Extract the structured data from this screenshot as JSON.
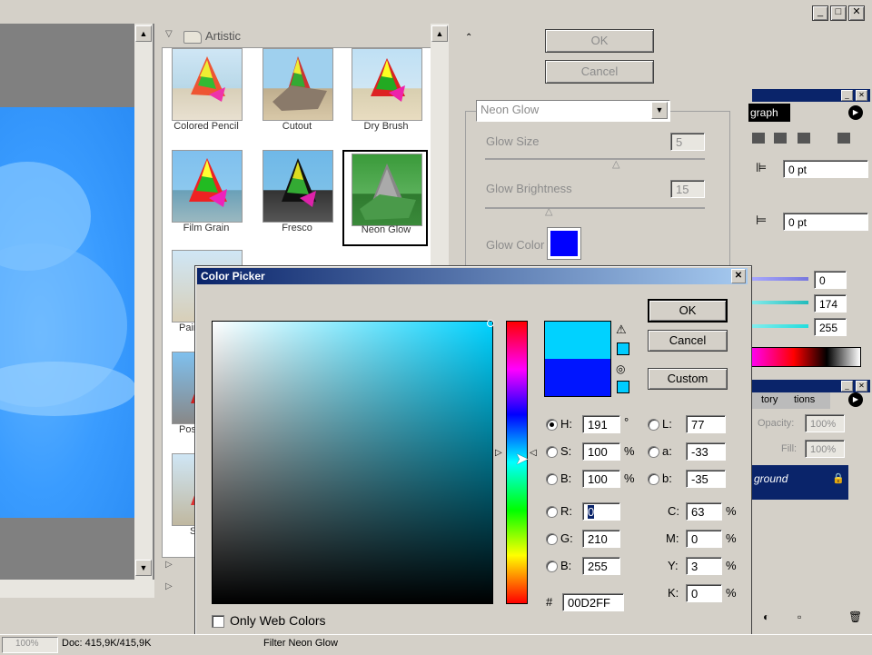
{
  "titlebar": {
    "min": "_",
    "max": "□",
    "close": "✕"
  },
  "filter_gallery": {
    "category": "Artistic",
    "thumbnails": [
      {
        "label": "Colored Pencil"
      },
      {
        "label": "Cutout"
      },
      {
        "label": "Dry Brush"
      },
      {
        "label": "Film Grain"
      },
      {
        "label": "Fresco"
      },
      {
        "label": "Neon Glow"
      }
    ],
    "partial_labels": [
      "Pair",
      "Post",
      "S"
    ],
    "ok_label": "OK",
    "cancel_label": "Cancel",
    "filter_select": "Neon Glow",
    "glow_size_label": "Glow Size",
    "glow_size_value": "5",
    "glow_brightness_label": "Glow Brightness",
    "glow_brightness_value": "15",
    "glow_color_label": "Glow Color",
    "glow_color": "#0000ff"
  },
  "right_panels": {
    "paragraph_tab": "graph",
    "indent_1": "0 pt",
    "indent_2": "0 pt",
    "slider_1": "0",
    "slider_2": "174",
    "slider_3": "255",
    "layers_tabs": [
      "tory",
      "tions"
    ],
    "opacity_label": "Opacity:",
    "opacity_value": "100%",
    "fill_label": "Fill:",
    "fill_value": "100%",
    "layer_name": "ground"
  },
  "color_picker": {
    "title": "Color Picker",
    "ok_label": "OK",
    "cancel_label": "Cancel",
    "custom_label": "Custom",
    "new_color": "#00d2ff",
    "old_color": "#0015ff",
    "web_swatch": "#00ccff",
    "h_label": "H:",
    "h_value": "191",
    "h_unit": "°",
    "s_label": "S:",
    "s_value": "100",
    "s_unit": "%",
    "b_label": "B:",
    "b_value": "100",
    "b_unit": "%",
    "r_label": "R:",
    "r_value": "0",
    "g_label": "G:",
    "g_value": "210",
    "bl_label": "B:",
    "bl_value": "255",
    "l_label": "L:",
    "l_value": "77",
    "a_label": "a:",
    "a_value": "-33",
    "lb_label": "b:",
    "lb_value": "-35",
    "c_label": "C:",
    "c_value": "63",
    "c_unit": "%",
    "m_label": "M:",
    "m_value": "0",
    "m_unit": "%",
    "y_label": "Y:",
    "y_value": "3",
    "y_unit": "%",
    "k_label": "K:",
    "k_value": "0",
    "k_unit": "%",
    "hex_label": "#",
    "hex_value": "00D2FF",
    "web_only_label": "Only Web Colors"
  },
  "statusbar": {
    "zoom": "100%",
    "doc": "Doc: 415,9K/415,9K",
    "status": "Filter Neon Glow"
  }
}
